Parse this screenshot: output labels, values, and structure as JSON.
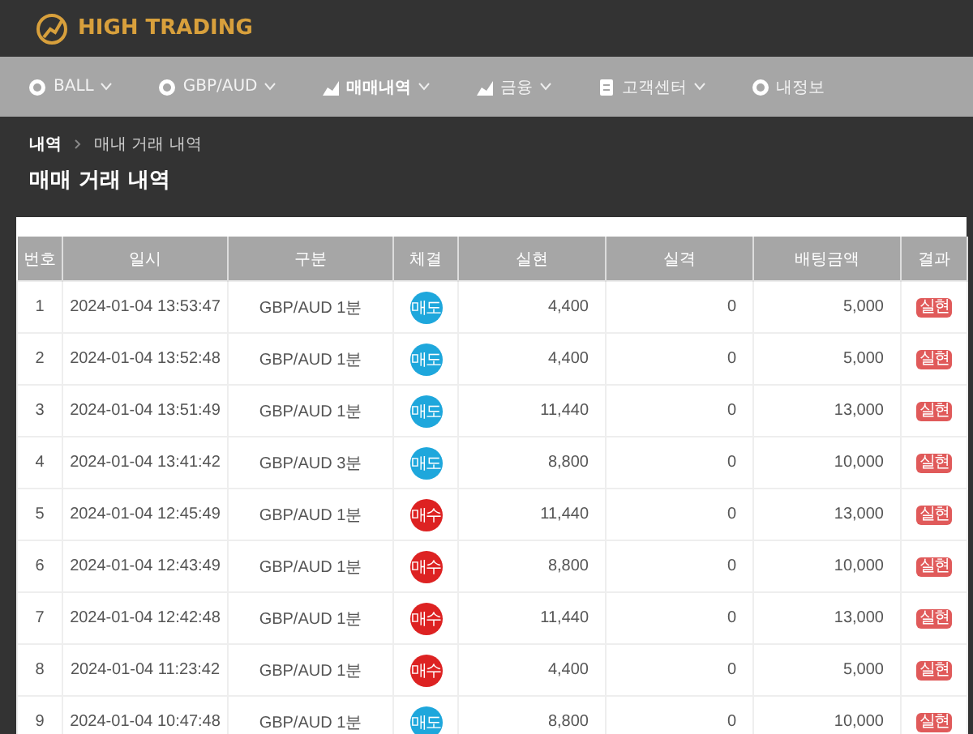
{
  "brand": {
    "name": "HIGH TRADING"
  },
  "nav": [
    {
      "label": "BALL",
      "selected": false,
      "dropdown": true
    },
    {
      "label": "GBP/AUD",
      "selected": false,
      "dropdown": true
    },
    {
      "label": "매매내역",
      "selected": true,
      "dropdown": true
    },
    {
      "label": "금융",
      "selected": false,
      "dropdown": true
    },
    {
      "label": "고객센터",
      "selected": false,
      "dropdown": true
    },
    {
      "label": "내정보",
      "selected": false,
      "dropdown": false
    }
  ],
  "breadcrumb": [
    "내역",
    "매내 거래 내역"
  ],
  "page_title": "매매 거래 내역",
  "table": {
    "columns": [
      "번호",
      "일시",
      "구분",
      "체결",
      "실현",
      "실격",
      "배팅금액",
      "결과"
    ],
    "rows": [
      {
        "no": "1",
        "time": "2024-01-04 13:53:47",
        "type": "GBP/AUD 1분",
        "trade": {
          "label": "매도",
          "color": "#1ea7dc"
        },
        "realized": "4,400",
        "lost": "0",
        "bet": "5,000",
        "result": "실현"
      },
      {
        "no": "2",
        "time": "2024-01-04 13:52:48",
        "type": "GBP/AUD 1분",
        "trade": {
          "label": "매도",
          "color": "#1ea7dc"
        },
        "realized": "4,400",
        "lost": "0",
        "bet": "5,000",
        "result": "실현"
      },
      {
        "no": "3",
        "time": "2024-01-04 13:51:49",
        "type": "GBP/AUD 1분",
        "trade": {
          "label": "매도",
          "color": "#1ea7dc"
        },
        "realized": "11,440",
        "lost": "0",
        "bet": "13,000",
        "result": "실현"
      },
      {
        "no": "4",
        "time": "2024-01-04 13:41:42",
        "type": "GBP/AUD 3분",
        "trade": {
          "label": "매도",
          "color": "#1ea7dc"
        },
        "realized": "8,800",
        "lost": "0",
        "bet": "10,000",
        "result": "실현"
      },
      {
        "no": "5",
        "time": "2024-01-04 12:45:49",
        "type": "GBP/AUD 1분",
        "trade": {
          "label": "매수",
          "color": "#dd2222"
        },
        "realized": "11,440",
        "lost": "0",
        "bet": "13,000",
        "result": "실현"
      },
      {
        "no": "6",
        "time": "2024-01-04 12:43:49",
        "type": "GBP/AUD 1분",
        "trade": {
          "label": "매수",
          "color": "#dd2222"
        },
        "realized": "8,800",
        "lost": "0",
        "bet": "10,000",
        "result": "실현"
      },
      {
        "no": "7",
        "time": "2024-01-04 12:42:48",
        "type": "GBP/AUD 1분",
        "trade": {
          "label": "매수",
          "color": "#dd2222"
        },
        "realized": "11,440",
        "lost": "0",
        "bet": "13,000",
        "result": "실현"
      },
      {
        "no": "8",
        "time": "2024-01-04 11:23:42",
        "type": "GBP/AUD 1분",
        "trade": {
          "label": "매수",
          "color": "#dd2222"
        },
        "realized": "4,400",
        "lost": "0",
        "bet": "5,000",
        "result": "실현"
      },
      {
        "no": "9",
        "time": "2024-01-04 10:47:48",
        "type": "GBP/AUD 1분",
        "trade": {
          "label": "매도",
          "color": "#1ea7dc"
        },
        "realized": "8,800",
        "lost": "0",
        "bet": "10,000",
        "result": "실현"
      }
    ]
  }
}
